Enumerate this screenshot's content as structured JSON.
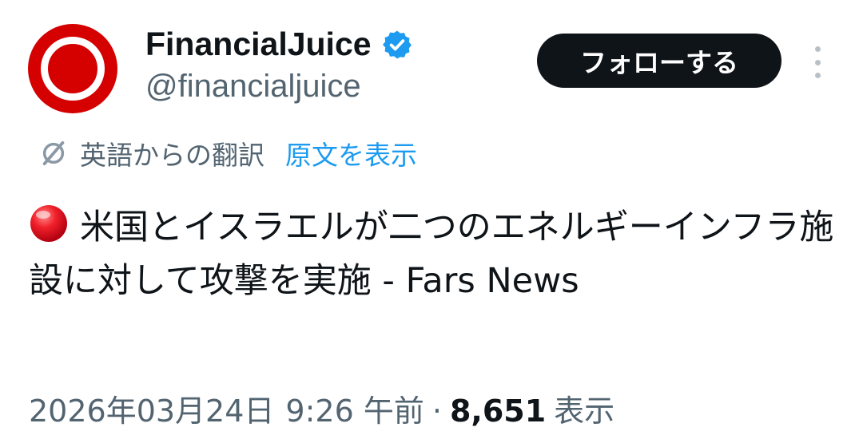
{
  "account": {
    "display_name": "FinancialJuice",
    "handle": "@financialjuice",
    "verified": true,
    "avatar_icon": "red-ring-logo",
    "verified_color": "#1d9bf0"
  },
  "header": {
    "follow_label": "フォローする",
    "more_icon": "more-vertical-icon"
  },
  "translation": {
    "icon": "translate-slash-icon",
    "label": "英語からの翻訳",
    "show_original_label": "原文を表示",
    "link_color": "#1d9bf0"
  },
  "tweet": {
    "emoji": "red-circle",
    "text": "米国とイスラエルが二つのエネルギーインフラ施設に対して攻撃を実施 - Fars News"
  },
  "meta": {
    "date": "2026年03月24日",
    "time": "9:26 午前",
    "separator": "·",
    "views_count": "8,651",
    "views_label": "表示"
  }
}
